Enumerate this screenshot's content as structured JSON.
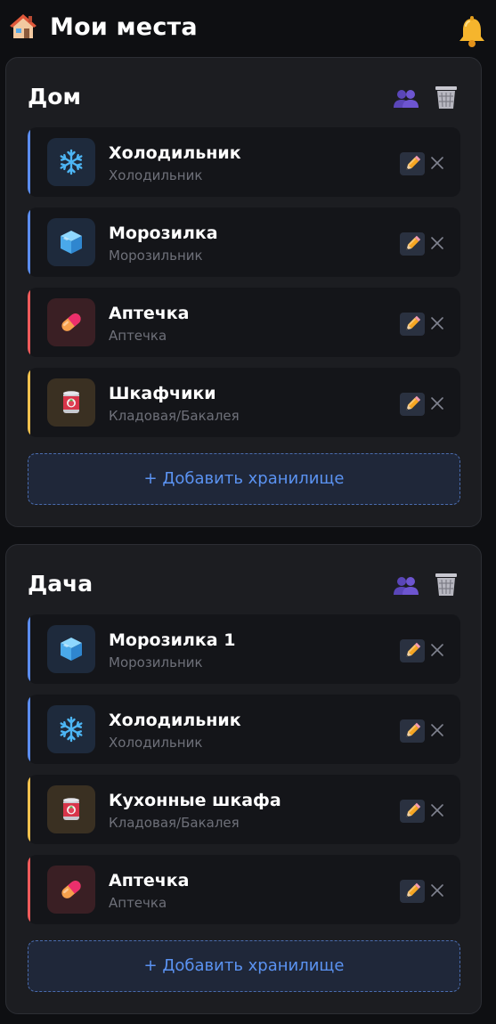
{
  "header": {
    "title": "Мои места",
    "home_icon": "house-icon",
    "bell_icon": "bell-icon"
  },
  "colors": {
    "fridge": "#5b8def",
    "freezer": "#5b8def",
    "medkit": "#ef5b5b",
    "pantry": "#f2c14e",
    "accent": "#5b93f2"
  },
  "places": [
    {
      "title": "Дом",
      "storages": [
        {
          "name": "Холодильник",
          "type": "Холодильник",
          "icon": "snowflake-icon"
        },
        {
          "name": "Морозилка",
          "type": "Морозильник",
          "icon": "ice-cube-icon"
        },
        {
          "name": "Аптечка",
          "type": "Аптечка",
          "icon": "pill-icon"
        },
        {
          "name": "Шкафчики",
          "type": "Кладовая/Бакалея",
          "icon": "tin-can-icon"
        }
      ],
      "add_label": "+ Добавить хранилище"
    },
    {
      "title": "Дача",
      "storages": [
        {
          "name": "Морозилка 1",
          "type": "Морозильник",
          "icon": "ice-cube-icon"
        },
        {
          "name": "Холодильник",
          "type": "Холодильник",
          "icon": "snowflake-icon"
        },
        {
          "name": "Кухонные шкафа",
          "type": "Кладовая/Бакалея",
          "icon": "tin-can-icon"
        },
        {
          "name": "Аптечка",
          "type": "Аптечка",
          "icon": "pill-icon"
        }
      ],
      "add_label": "+ Добавить хранилище"
    }
  ]
}
